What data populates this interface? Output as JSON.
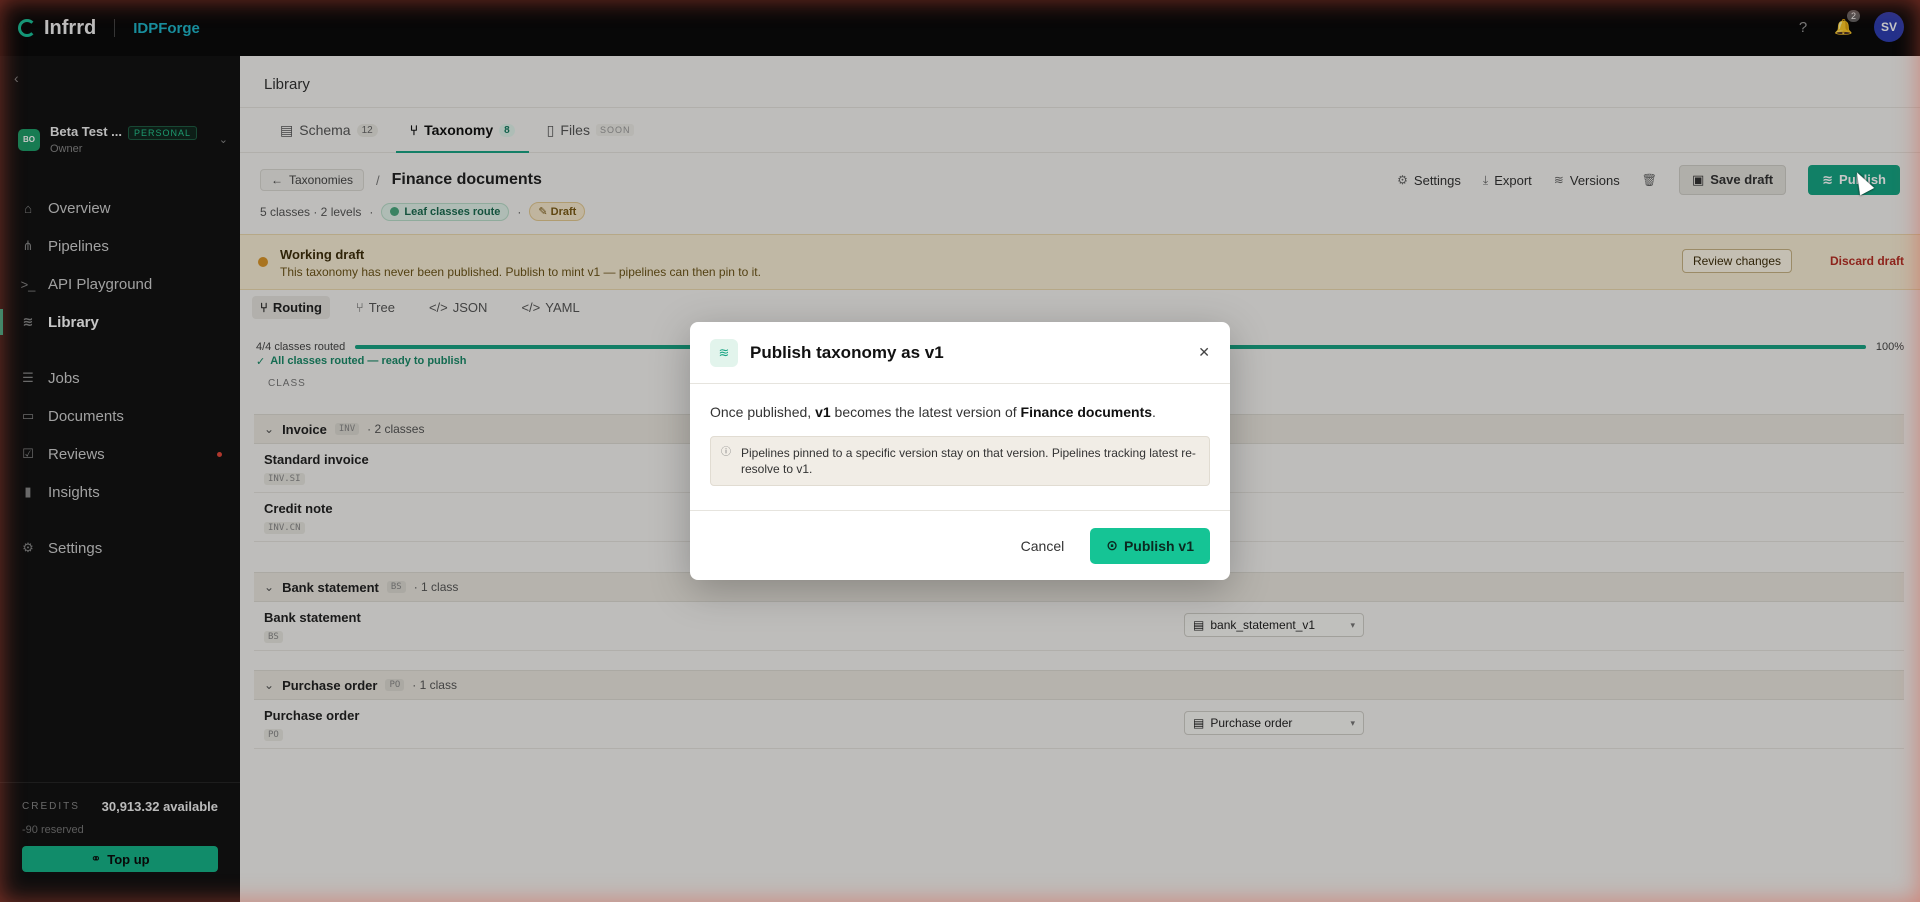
{
  "topbar": {
    "brand": "Infrrd",
    "product": "IDPForge",
    "notifications": "2",
    "avatar": "SV"
  },
  "sidebar": {
    "workspace": {
      "badge": "BO",
      "name": "Beta Test ...",
      "tag": "PERSONAL",
      "role": "Owner"
    },
    "items": [
      {
        "label": "Overview"
      },
      {
        "label": "Pipelines"
      },
      {
        "label": "API Playground"
      },
      {
        "label": "Library"
      },
      {
        "label": "Jobs"
      },
      {
        "label": "Documents"
      },
      {
        "label": "Reviews"
      },
      {
        "label": "Insights"
      },
      {
        "label": "Settings"
      }
    ],
    "credits": {
      "label": "CREDITS",
      "available": "30,913.32 available",
      "reserved": "-90 reserved",
      "topup": "Top up"
    }
  },
  "main": {
    "header": "Library",
    "tabs": [
      {
        "label": "Schema",
        "count": "12"
      },
      {
        "label": "Taxonomy",
        "count": "8"
      },
      {
        "label": "Files",
        "badge": "SOON"
      }
    ],
    "back": "Taxonomies",
    "title": "Finance documents",
    "actions": {
      "settings": "Settings",
      "export": "Export",
      "versions": "Versions",
      "save_draft": "Save draft",
      "publish": "Publish"
    },
    "meta": {
      "summary": "5 classes · 2 levels",
      "route": "Leaf classes route",
      "status": "Draft"
    },
    "banner": {
      "title": "Working draft",
      "text": "This taxonomy has never been published. Publish to mint v1 — pipelines can then pin to it.",
      "review": "Review changes",
      "discard": "Discard draft"
    },
    "views": [
      "Routing",
      "Tree",
      "JSON",
      "YAML"
    ],
    "progress": {
      "label": "4/4 classes routed",
      "percent": "100%",
      "value": 1.0,
      "ok": "All classes routed — ready to publish"
    },
    "column": "CLASS",
    "groups": [
      {
        "name": "Invoice",
        "code": "INV",
        "count": "· 2 classes"
      },
      {
        "name": "Bank statement",
        "code": "BS",
        "count": "· 1 class"
      },
      {
        "name": "Purchase order",
        "code": "PO",
        "count": "· 1 class"
      }
    ],
    "rows": [
      {
        "name": "Standard invoice",
        "code": "INV.SI"
      },
      {
        "name": "Credit note",
        "code": "INV.CN"
      },
      {
        "name": "Bank statement",
        "code": "BS",
        "schema": "bank_statement_v1"
      },
      {
        "name": "Purchase order",
        "code": "PO",
        "schema": "Purchase order"
      }
    ]
  },
  "modal": {
    "title": "Publish taxonomy as v1",
    "lead_prefix": "Once published,",
    "version": "v1",
    "lead_mid": "becomes the latest version of",
    "doc": "Finance documents",
    "lead_end": ".",
    "note": "Pipelines pinned to a specific version stay on that version. Pipelines tracking latest re-resolve to v1.",
    "cancel": "Cancel",
    "confirm": "Publish v1"
  }
}
